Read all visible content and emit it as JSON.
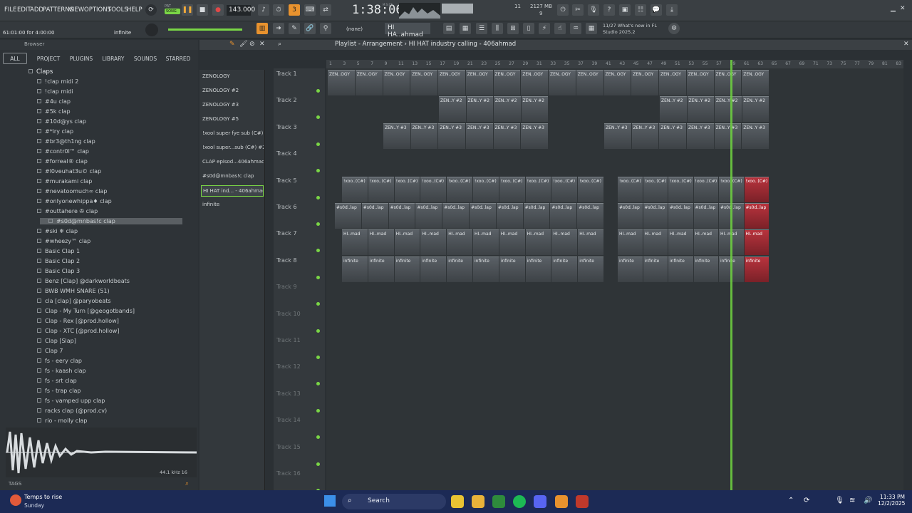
{
  "menu": [
    "FILE",
    "EDIT",
    "ADD",
    "PATTERNS",
    "VIEW",
    "OPTIONS",
    "TOOLS",
    "HELP"
  ],
  "transport": {
    "mode_pat": "PAT",
    "mode_song": "SONG",
    "tempo": "143.000",
    "time": "1:38:06",
    "time_label": "M:S:CS",
    "cpu": "11",
    "mem": "2127 MB",
    "voices": "9"
  },
  "hint": {
    "position": "61:01:00 for 4:00:00",
    "label": "infinite"
  },
  "pattern_selector": "HI HA..ahmad",
  "snap": "(none)",
  "news": {
    "date": "11/27",
    "text1": "What's new in FL",
    "text2": "Studio 2025.2"
  },
  "browser": {
    "title": "Browser",
    "tabs": [
      "ALL",
      "PROJECT",
      "PLUGINS",
      "LIBRARY",
      "SOUNDS",
      "STARRED"
    ],
    "folder": "Claps",
    "items": [
      "!clap midi 2",
      "!clap midi",
      "#4u clap",
      "#5k clap",
      "#10d@ys clap",
      "#*iry clap",
      "#br3@th1ng clap",
      "#contr0l™ clap",
      "#forreal® clap",
      "#l0veuhat3u© clap",
      "#murakami clap",
      "#nevatoomuch∞ clap",
      "#onlyonewhippa♦ clap",
      "#outtahere ✇ clap",
      "#s0d@mnbas!c clap",
      "#ski ❄ clap",
      "#wheezy™ clap",
      "Basic Clap 1",
      "Basic Clap 2",
      "Basic Clap 3",
      "Benz [Clap] @darkworldbeats",
      "BWB WMH SNARE (51)",
      "cla [clap] @paryobeats",
      "Clap - My Turn [@geogotbands]",
      "Clap - Rex [@prod.hollow]",
      "Clap - XTC [@prod.hollow]",
      "Clap [Slap]",
      "Clap 7",
      "fs - eery clap",
      "fs - kaash clap",
      "fs - srt clap",
      "fs - trap clap",
      "fs - vamped upp clap",
      "racks clap (@prod.cv)",
      "rio - molly clap"
    ],
    "selected_index": 14,
    "sample_info": "44.1 kHz 16",
    "tags": "TAGS"
  },
  "patterns": [
    "ZENOLOGY",
    "ZENOLOGY #2",
    "ZENOLOGY #3",
    "ZENOLOGY #5",
    "!xool super fye sub (C#)",
    "!xool super...sub (C#) #2",
    "CLAP episod...406ahmad",
    "#s0d@mnbas!c clap",
    "HI HAT ind... - 406ahmad",
    "infinite"
  ],
  "playlist": {
    "title": "Playlist - Arrangement",
    "crumb": "HI HAT industry calling - 406ahmad",
    "tracks": [
      "Track 1",
      "Track 2",
      "Track 3",
      "Track 4",
      "Track 5",
      "Track 6",
      "Track 7",
      "Track 8",
      "Track 9",
      "Track 10",
      "Track 11",
      "Track 12",
      "Track 13",
      "Track 14",
      "Track 15",
      "Track 16"
    ],
    "bars": [
      "1",
      "3",
      "5",
      "7",
      "9",
      "11",
      "13",
      "15",
      "17",
      "19",
      "21",
      "23",
      "25",
      "27",
      "29",
      "31",
      "33",
      "35",
      "37",
      "39",
      "41",
      "43",
      "45",
      "47",
      "49",
      "51",
      "53",
      "55",
      "57",
      "59",
      "61",
      "63",
      "65",
      "67",
      "69",
      "71",
      "73",
      "75",
      "77",
      "79",
      "81",
      "83"
    ],
    "clip_labels": {
      "t1": "ZEN..OGY",
      "t2": "ZEN..Y #2",
      "t3": "ZEN..Y #3",
      "t5": "!xoo..(C#)",
      "t6": "#s0d..lap",
      "t7": "HI..mad",
      "t8": "infinite"
    }
  },
  "taskbar": {
    "weather": "Temps to rise",
    "day": "Sunday",
    "search": "Search",
    "time": "11:33 PM",
    "date": "12/2/2025"
  }
}
